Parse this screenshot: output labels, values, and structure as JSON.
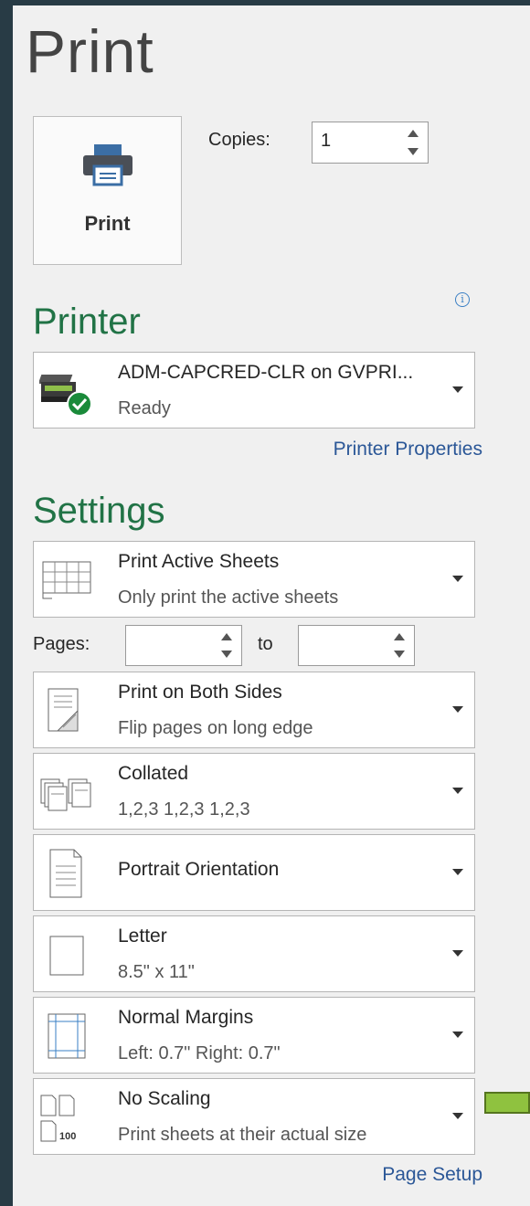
{
  "title": "Print",
  "print_button": {
    "label": "Print",
    "icon": "printer-icon"
  },
  "copies": {
    "label": "Copies:",
    "value": "1"
  },
  "printer_section": {
    "heading": "Printer",
    "selected": {
      "name": "ADM-CAPCRED-CLR on GVPRI...",
      "status": "Ready"
    },
    "properties_link": "Printer Properties"
  },
  "settings_section": {
    "heading": "Settings",
    "print_what": {
      "main": "Print Active Sheets",
      "sub": "Only print the active sheets"
    },
    "pages": {
      "label": "Pages:",
      "to_label": "to",
      "from_value": "",
      "to_value": ""
    },
    "sides": {
      "main": "Print on Both Sides",
      "sub": "Flip pages on long edge"
    },
    "collation": {
      "main": "Collated",
      "sub": "1,2,3    1,2,3    1,2,3"
    },
    "orientation": {
      "main": "Portrait Orientation"
    },
    "paper": {
      "main": "Letter",
      "sub": "8.5\" x 11\""
    },
    "margins": {
      "main": "Normal Margins",
      "sub": "Left:  0.7\"    Right:  0.7\""
    },
    "scaling": {
      "main": "No Scaling",
      "sub": "Print sheets at their actual size",
      "icon_badge": "100"
    },
    "page_setup_link": "Page Setup"
  },
  "colors": {
    "accent_green": "#217346",
    "link_blue": "#2b5797",
    "pointer_green": "#8fc23f"
  }
}
